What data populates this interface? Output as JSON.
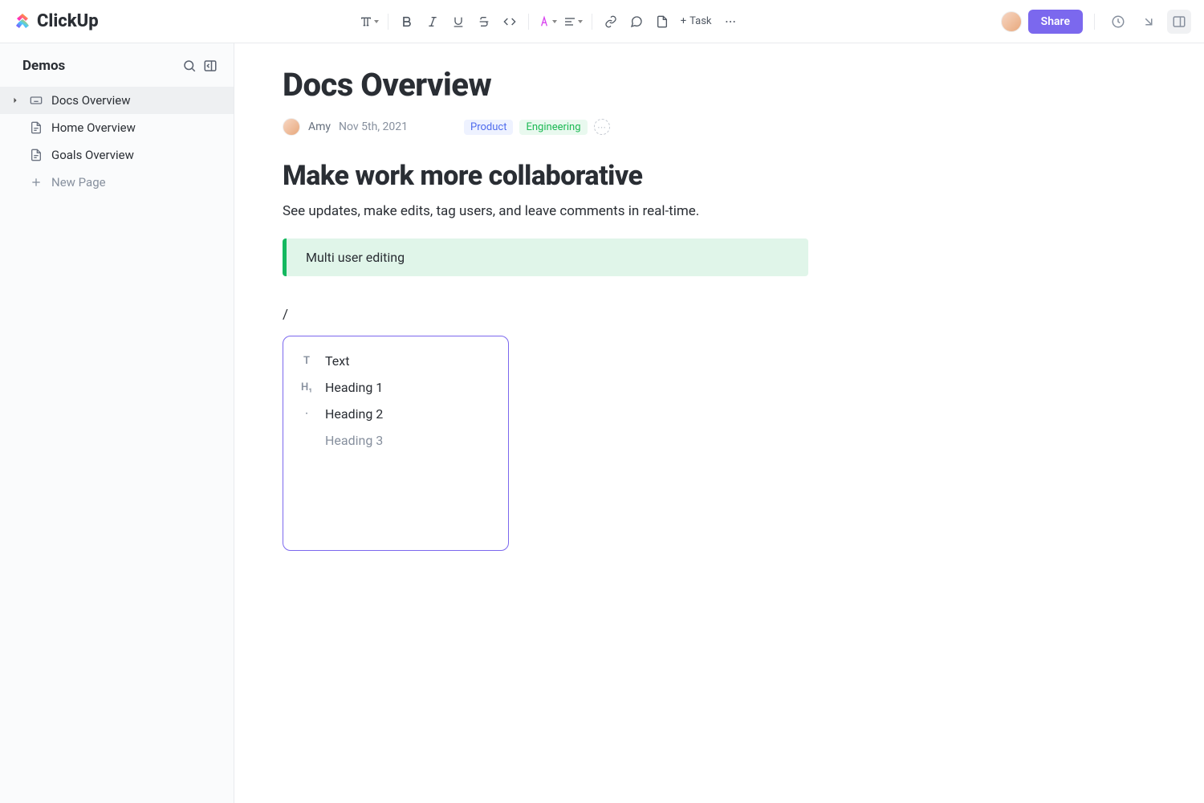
{
  "brand": {
    "name": "ClickUp"
  },
  "toolbar": {
    "task_label": "Task"
  },
  "header": {
    "share_label": "Share"
  },
  "sidebar": {
    "title": "Demos",
    "items": [
      {
        "label": "Docs Overview",
        "active": true,
        "icon": "keyboard"
      },
      {
        "label": "Home Overview",
        "active": false,
        "icon": "doc"
      },
      {
        "label": "Goals Overview",
        "active": false,
        "icon": "doc"
      }
    ],
    "new_page_label": "New Page"
  },
  "doc": {
    "title": "Docs Overview",
    "author": "Amy",
    "date": "Nov 5th, 2021",
    "tags": [
      {
        "label": "Product",
        "class": "product"
      },
      {
        "label": "Engineering",
        "class": "eng"
      }
    ],
    "heading": "Make work more collaborative",
    "body": "See updates, make edits, tag users, and leave comments in real-time.",
    "callout": "Multi user editing",
    "slash_trigger": "/"
  },
  "slash_menu": {
    "items": [
      {
        "label": "Text",
        "icon": "T",
        "fade": false
      },
      {
        "label": "Heading 1",
        "icon": "H₁",
        "fade": false
      },
      {
        "label": "Heading 2",
        "icon": "·",
        "fade": false
      },
      {
        "label": "Heading 3",
        "icon": "",
        "fade": true
      }
    ]
  }
}
